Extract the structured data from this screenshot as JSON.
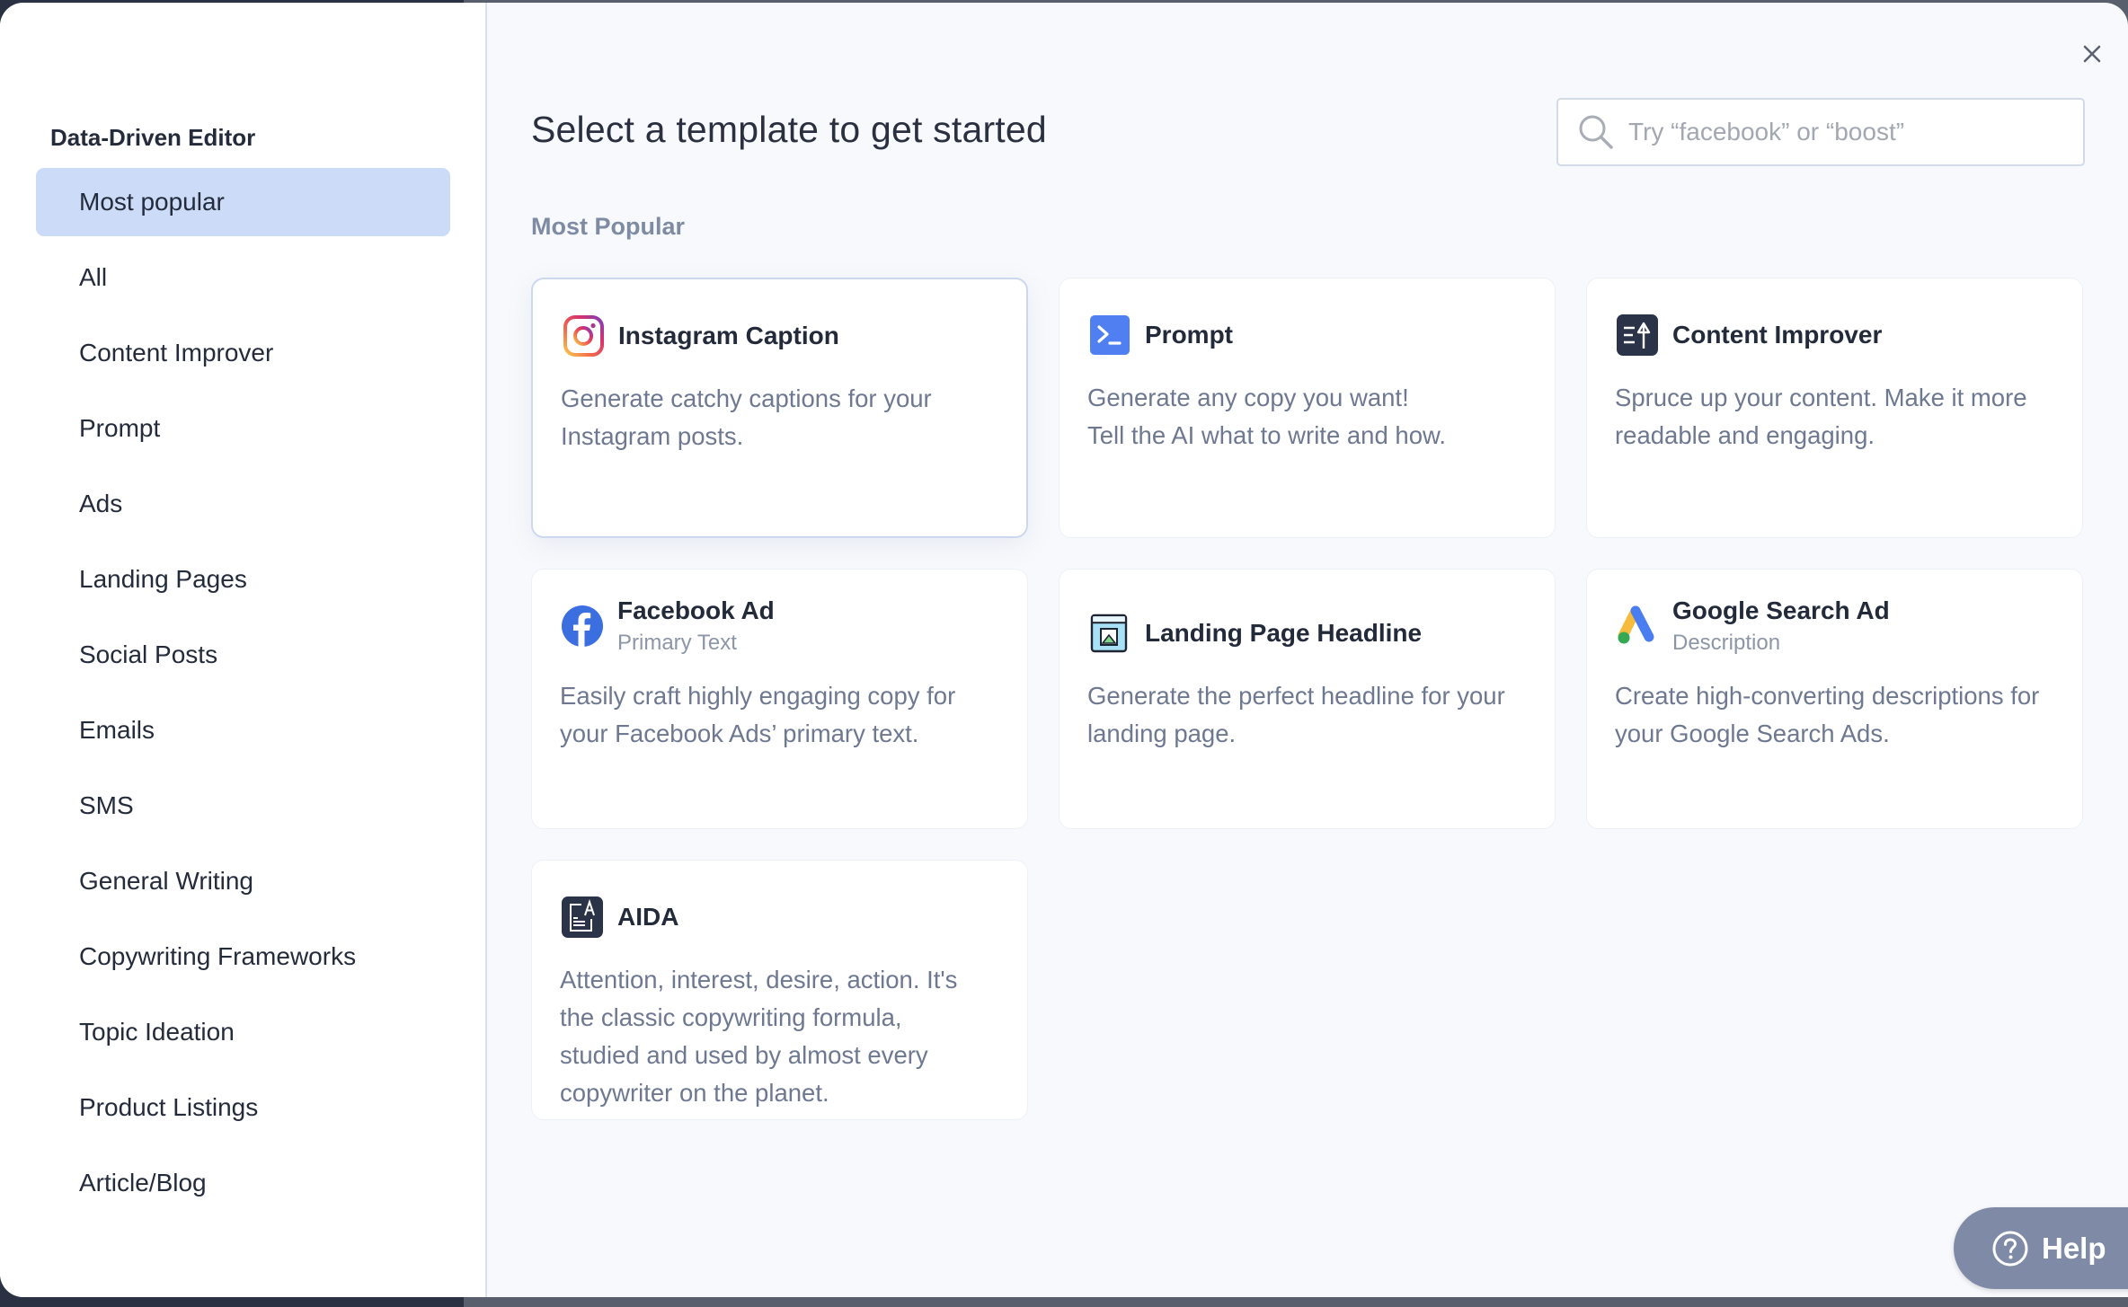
{
  "sidebar": {
    "title": "Data-Driven Editor",
    "items": [
      {
        "label": "Most popular",
        "active": true
      },
      {
        "label": "All"
      },
      {
        "label": "Content Improver"
      },
      {
        "label": "Prompt"
      },
      {
        "label": "Ads"
      },
      {
        "label": "Landing Pages"
      },
      {
        "label": "Social Posts"
      },
      {
        "label": "Emails"
      },
      {
        "label": "SMS"
      },
      {
        "label": "General Writing"
      },
      {
        "label": "Copywriting Frameworks"
      },
      {
        "label": "Topic Ideation"
      },
      {
        "label": "Product Listings"
      },
      {
        "label": "Article/Blog"
      }
    ]
  },
  "header": {
    "title": "Select a template to get started",
    "search_placeholder": "Try “facebook” or “boost”",
    "search_value": ""
  },
  "section": {
    "label": "Most Popular"
  },
  "cards": [
    {
      "icon": "instagram-icon",
      "title": "Instagram Caption",
      "subtitle": "",
      "description": "Generate catchy captions for your\nInstagram posts."
    },
    {
      "icon": "prompt-terminal-icon",
      "title": "Prompt",
      "subtitle": "",
      "description": "Generate any copy you want!\nTell the AI what to write and how."
    },
    {
      "icon": "content-improver-icon",
      "title": "Content Improver",
      "subtitle": "",
      "description": "Spruce up your content. Make it more\nreadable and engaging."
    },
    {
      "icon": "facebook-icon",
      "title": "Facebook Ad",
      "subtitle": "Primary Text",
      "description": "Easily craft highly engaging copy for\nyour Facebook Ads’ primary text."
    },
    {
      "icon": "landing-page-icon",
      "title": "Landing Page Headline",
      "subtitle": "",
      "description": "Generate the perfect headline for your\nlanding page."
    },
    {
      "icon": "google-ads-icon",
      "title": "Google Search Ad",
      "subtitle": "Description",
      "description": "Create high-converting descriptions for\nyour Google Search Ads."
    },
    {
      "icon": "aida-icon",
      "title": "AIDA",
      "subtitle": "",
      "description": "Attention, interest, desire, action. It's\nthe classic copywriting formula,\nstudied and used by almost every\ncopywriter on the planet."
    }
  ],
  "help": {
    "label": "Help"
  },
  "colors": {
    "active_item_bg": "#cbdbf8",
    "help_bg": "#7f8ba6",
    "section_label": "#7e8ba3",
    "prompt_blue": "#4f7ff0",
    "dark_icon": "#2a3347"
  }
}
